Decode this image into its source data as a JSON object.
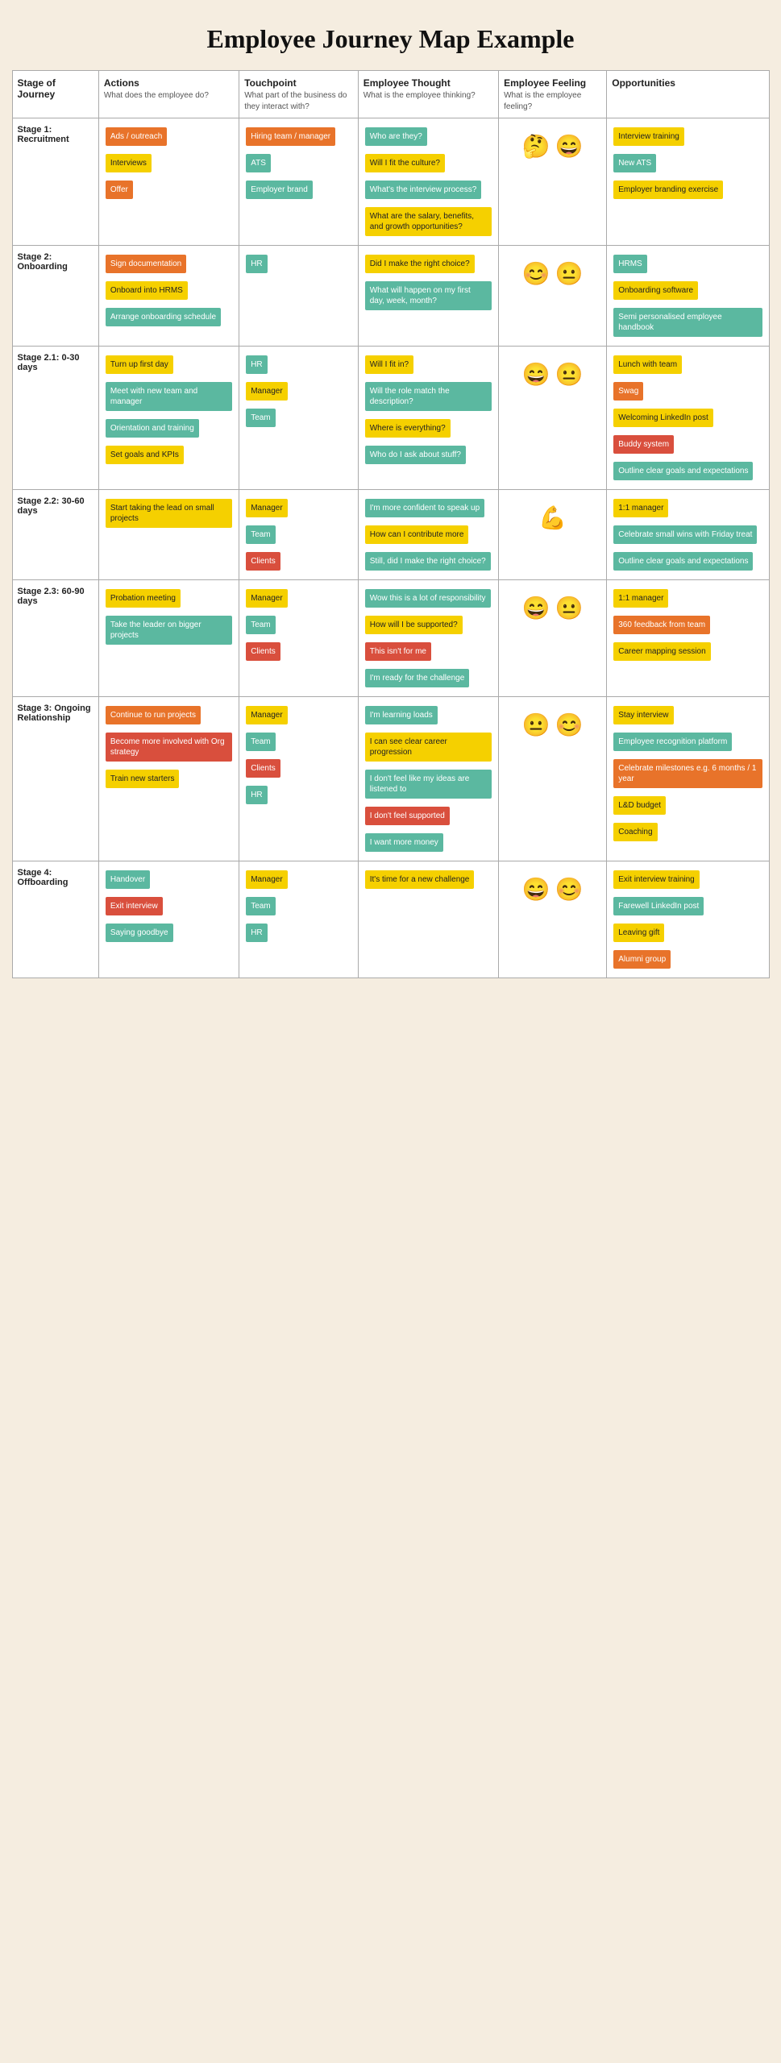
{
  "title": "Employee Journey Map Example",
  "headers": {
    "stage": {
      "label": "Stage of Journey",
      "sub": ""
    },
    "actions": {
      "label": "Actions",
      "sub": "What does the employee do?"
    },
    "touchpoint": {
      "label": "Touchpoint",
      "sub": "What part of the business do they interact with?"
    },
    "thought": {
      "label": "Employee Thought",
      "sub": "What is the employee thinking?"
    },
    "feeling": {
      "label": "Employee Feeling",
      "sub": "What is the employee feeling?"
    },
    "opps": {
      "label": "Opportunities",
      "sub": ""
    }
  },
  "stages": [
    {
      "id": "stage1",
      "label": "Stage 1: Recruitment",
      "actions": [
        {
          "text": "Ads / outreach",
          "color": "orange"
        },
        {
          "text": "Interviews",
          "color": "yellow"
        },
        {
          "text": "Offer",
          "color": "orange"
        }
      ],
      "touchpoints": [
        {
          "text": "Hiring team / manager",
          "color": "orange"
        },
        {
          "text": "ATS",
          "color": "teal"
        },
        {
          "text": "Employer brand",
          "color": "teal"
        }
      ],
      "thoughts": [
        {
          "text": "Who are they?",
          "color": "teal"
        },
        {
          "text": "Will I fit the culture?",
          "color": "yellow"
        },
        {
          "text": "What's the interview process?",
          "color": "teal"
        },
        {
          "text": "What are the salary, benefits, and growth opportunities?",
          "color": "yellow"
        }
      ],
      "feeling_emojis": [
        "🤔",
        "😄"
      ],
      "opportunities": [
        {
          "text": "Interview training",
          "color": "yellow"
        },
        {
          "text": "New ATS",
          "color": "teal"
        },
        {
          "text": "Employer branding exercise",
          "color": "yellow"
        }
      ]
    },
    {
      "id": "stage2",
      "label": "Stage 2: Onboarding",
      "actions": [
        {
          "text": "Sign documentation",
          "color": "orange"
        },
        {
          "text": "Onboard into HRMS",
          "color": "yellow"
        },
        {
          "text": "Arrange onboarding schedule",
          "color": "teal"
        }
      ],
      "touchpoints": [
        {
          "text": "HR",
          "color": "teal"
        }
      ],
      "thoughts": [
        {
          "text": "Did I make the right choice?",
          "color": "yellow"
        },
        {
          "text": "What will happen on my first day, week, month?",
          "color": "teal"
        }
      ],
      "feeling_emojis": [
        "😊",
        "😐"
      ],
      "opportunities": [
        {
          "text": "HRMS",
          "color": "teal"
        },
        {
          "text": "Onboarding software",
          "color": "yellow"
        },
        {
          "text": "Semi personalised employee handbook",
          "color": "teal"
        }
      ]
    },
    {
      "id": "stage2_1",
      "label": "Stage 2.1: 0-30 days",
      "actions": [
        {
          "text": "Turn up first day",
          "color": "yellow"
        },
        {
          "text": "Meet with new team and manager",
          "color": "teal"
        },
        {
          "text": "Orientation and training",
          "color": "teal"
        },
        {
          "text": "Set goals and KPIs",
          "color": "yellow"
        }
      ],
      "touchpoints": [
        {
          "text": "HR",
          "color": "teal"
        },
        {
          "text": "Manager",
          "color": "yellow"
        },
        {
          "text": "Team",
          "color": "teal"
        }
      ],
      "thoughts": [
        {
          "text": "Will I fit in?",
          "color": "yellow"
        },
        {
          "text": "Will the role match the description?",
          "color": "teal"
        },
        {
          "text": "Where is everything?",
          "color": "yellow"
        },
        {
          "text": "Who do I ask about stuff?",
          "color": "teal"
        }
      ],
      "feeling_emojis": [
        "😄",
        "😐"
      ],
      "opportunities": [
        {
          "text": "Lunch with team",
          "color": "yellow"
        },
        {
          "text": "Swag",
          "color": "orange"
        },
        {
          "text": "Welcoming LinkedIn post",
          "color": "yellow"
        },
        {
          "text": "Buddy system",
          "color": "red"
        },
        {
          "text": "Outline clear goals and expectations",
          "color": "teal"
        }
      ]
    },
    {
      "id": "stage2_2",
      "label": "Stage 2.2: 30-60 days",
      "actions": [
        {
          "text": "Start taking the lead on small projects",
          "color": "yellow"
        }
      ],
      "touchpoints": [
        {
          "text": "Manager",
          "color": "yellow"
        },
        {
          "text": "Team",
          "color": "teal"
        },
        {
          "text": "Clients",
          "color": "red"
        }
      ],
      "thoughts": [
        {
          "text": "I'm more confident to speak up",
          "color": "teal"
        },
        {
          "text": "How can I contribute more",
          "color": "yellow"
        },
        {
          "text": "Still, did I make the right choice?",
          "color": "teal"
        }
      ],
      "feeling_emojis": [
        "💪"
      ],
      "opportunities": [
        {
          "text": "1:1 manager",
          "color": "yellow"
        },
        {
          "text": "Celebrate small wins with Friday treat",
          "color": "teal"
        },
        {
          "text": "Outline clear goals and expectations",
          "color": "teal"
        }
      ]
    },
    {
      "id": "stage2_3",
      "label": "Stage 2.3: 60-90 days",
      "actions": [
        {
          "text": "Probation meeting",
          "color": "yellow"
        },
        {
          "text": "Take the leader on bigger projects",
          "color": "teal"
        }
      ],
      "touchpoints": [
        {
          "text": "Manager",
          "color": "yellow"
        },
        {
          "text": "Team",
          "color": "teal"
        },
        {
          "text": "Clients",
          "color": "red"
        }
      ],
      "thoughts": [
        {
          "text": "Wow this is a lot of responsibility",
          "color": "teal"
        },
        {
          "text": "How will I be supported?",
          "color": "yellow"
        },
        {
          "text": "This isn't for me",
          "color": "red"
        },
        {
          "text": "I'm ready for the challenge",
          "color": "teal"
        }
      ],
      "feeling_emojis": [
        "😄",
        "😐"
      ],
      "opportunities": [
        {
          "text": "1:1 manager",
          "color": "yellow"
        },
        {
          "text": "360 feedback from team",
          "color": "orange"
        },
        {
          "text": "Career mapping session",
          "color": "yellow"
        }
      ]
    },
    {
      "id": "stage3",
      "label": "Stage 3: Ongoing Relationship",
      "actions": [
        {
          "text": "Continue to run projects",
          "color": "orange"
        },
        {
          "text": "Become more involved with Org strategy",
          "color": "red"
        },
        {
          "text": "Train new starters",
          "color": "yellow"
        }
      ],
      "touchpoints": [
        {
          "text": "Manager",
          "color": "yellow"
        },
        {
          "text": "Team",
          "color": "teal"
        },
        {
          "text": "Clients",
          "color": "red"
        },
        {
          "text": "HR",
          "color": "teal"
        }
      ],
      "thoughts": [
        {
          "text": "I'm learning loads",
          "color": "teal"
        },
        {
          "text": "I can see clear career progression",
          "color": "yellow"
        },
        {
          "text": "I don't feel like my ideas are listened to",
          "color": "teal"
        },
        {
          "text": "I don't feel supported",
          "color": "red"
        },
        {
          "text": "I want more money",
          "color": "teal"
        }
      ],
      "feeling_emojis": [
        "😐",
        "😊"
      ],
      "opportunities": [
        {
          "text": "Stay interview",
          "color": "yellow"
        },
        {
          "text": "Employee recognition platform",
          "color": "teal"
        },
        {
          "text": "Celebrate milestones e.g. 6 months / 1 year",
          "color": "orange"
        },
        {
          "text": "L&D budget",
          "color": "yellow"
        },
        {
          "text": "Coaching",
          "color": "yellow"
        }
      ]
    },
    {
      "id": "stage4",
      "label": "Stage 4: Offboarding",
      "actions": [
        {
          "text": "Handover",
          "color": "teal"
        },
        {
          "text": "Exit interview",
          "color": "red"
        },
        {
          "text": "Saying goodbye",
          "color": "teal"
        }
      ],
      "touchpoints": [
        {
          "text": "Manager",
          "color": "yellow"
        },
        {
          "text": "Team",
          "color": "teal"
        },
        {
          "text": "HR",
          "color": "teal"
        }
      ],
      "thoughts": [
        {
          "text": "It's time for a new challenge",
          "color": "yellow"
        }
      ],
      "feeling_emojis": [
        "😄",
        "😊"
      ],
      "opportunities": [
        {
          "text": "Exit interview training",
          "color": "yellow"
        },
        {
          "text": "Farewell LinkedIn post",
          "color": "teal"
        },
        {
          "text": "Leaving gift",
          "color": "yellow"
        },
        {
          "text": "Alumni group",
          "color": "orange"
        }
      ]
    }
  ]
}
